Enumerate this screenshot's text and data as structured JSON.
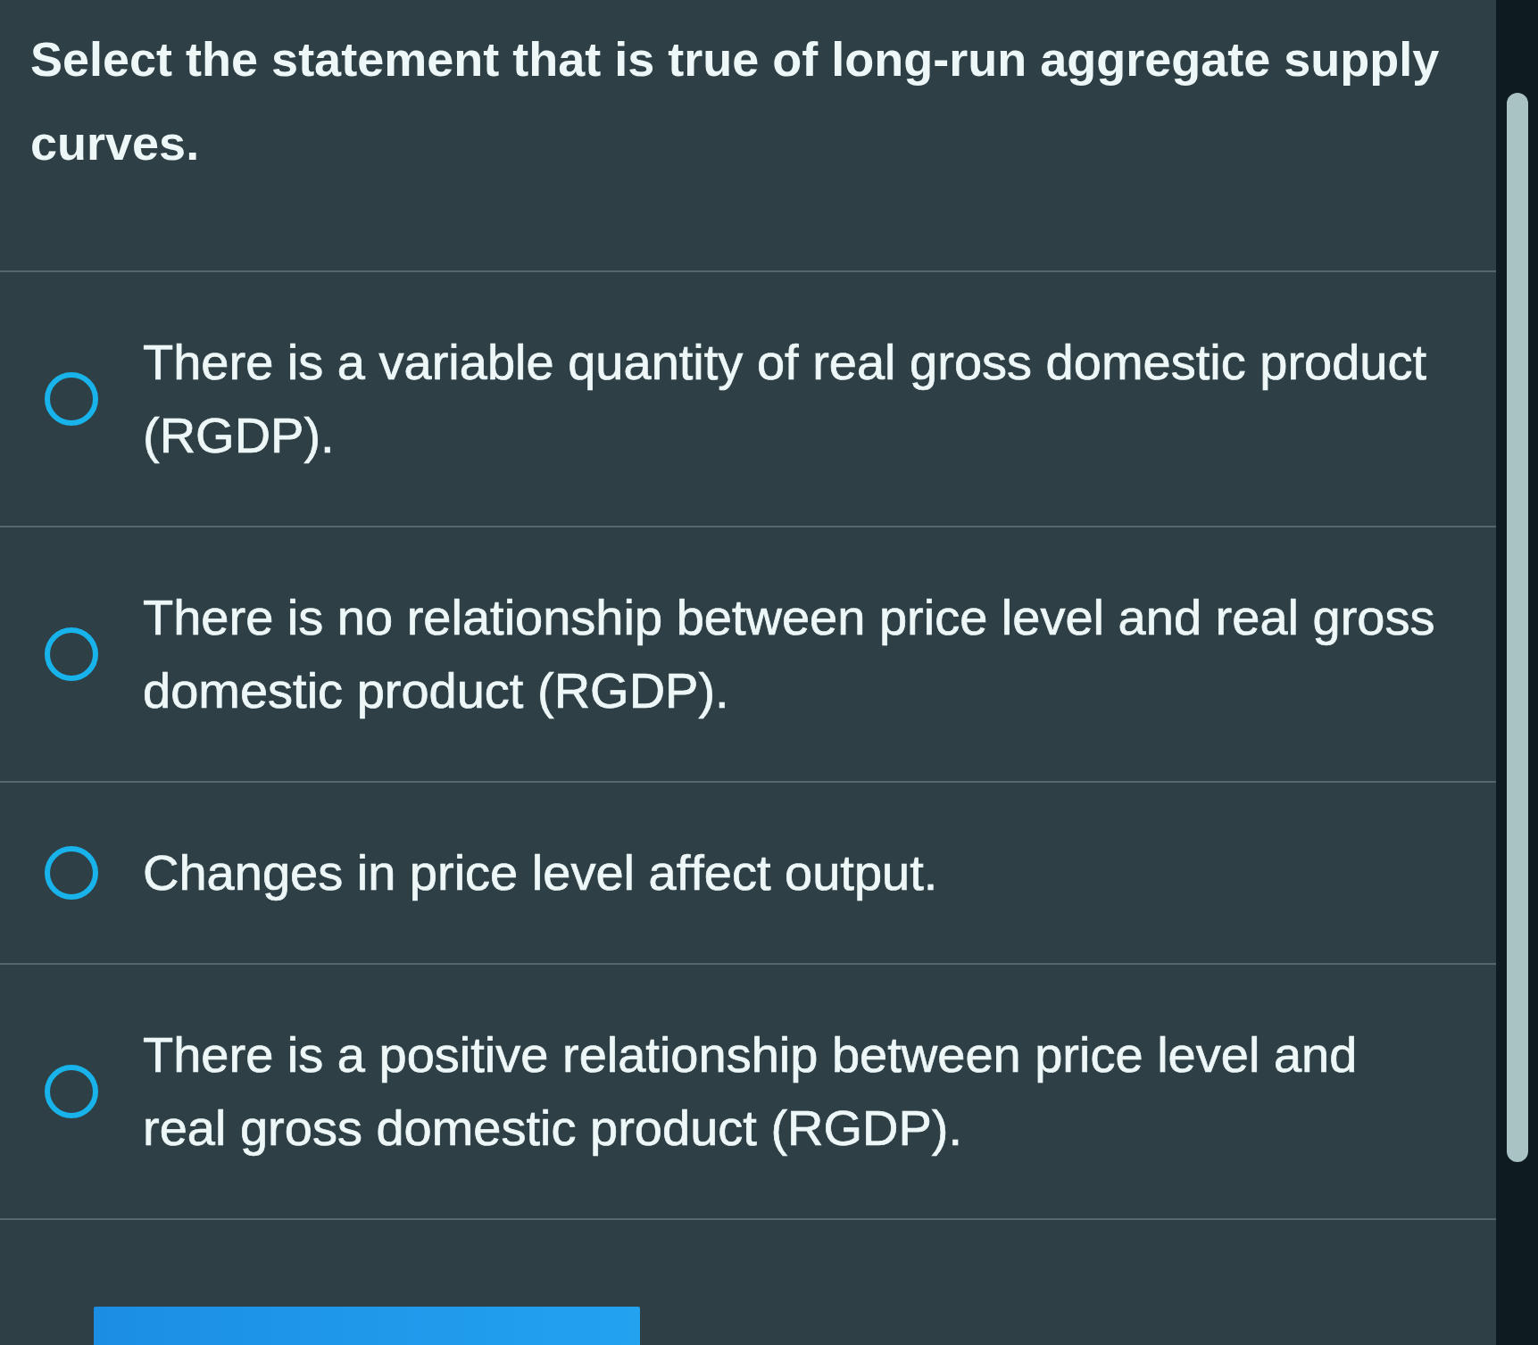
{
  "question": "Select the statement that is true of long-run aggregate supply curves.",
  "options": [
    {
      "text": "There is a variable quantity of real gross domestic product (RGDP).",
      "selected": false
    },
    {
      "text": "There is no relationship between price level and real gross domestic product (RGDP).",
      "selected": false
    },
    {
      "text": "Changes in price level affect output.",
      "selected": false
    },
    {
      "text": "There is a positive relationship between price level and real gross domestic product (RGDP).",
      "selected": false
    }
  ]
}
